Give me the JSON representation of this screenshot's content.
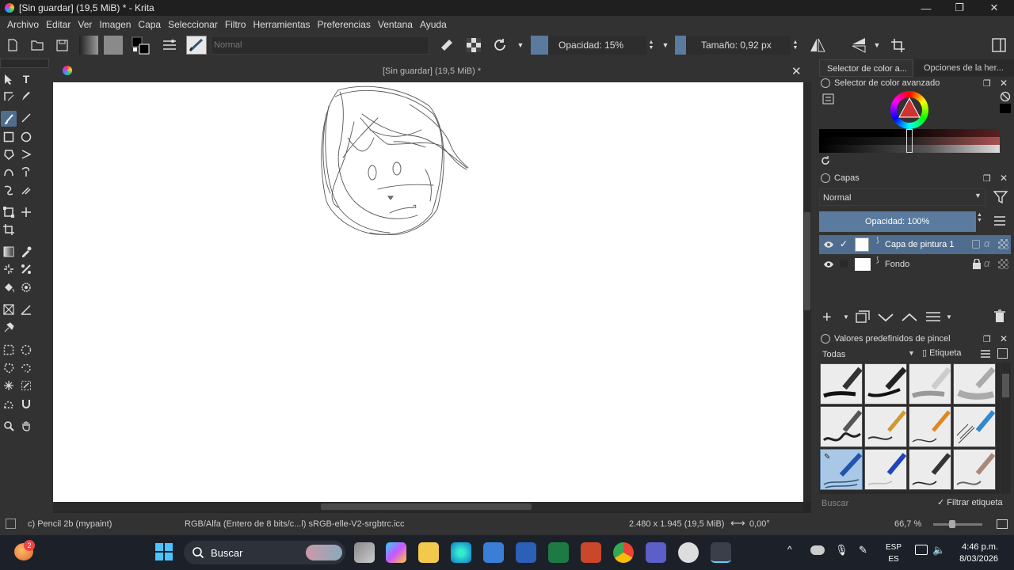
{
  "window": {
    "title": "[Sin guardar]  (19,5 MiB) * - Krita",
    "minimize": "—",
    "maximize": "❐",
    "close": "✕"
  },
  "menu": [
    "Archivo",
    "Editar",
    "Ver",
    "Imagen",
    "Capa",
    "Seleccionar",
    "Filtro",
    "Herramientas",
    "Preferencias",
    "Ventana",
    "Ayuda"
  ],
  "toolbar": {
    "blend_mode": "Normal",
    "opacity": "Opacidad: 15%",
    "size": "Tamaño: 0,92 px"
  },
  "document": {
    "title": "[Sin guardar]  (19,5 MiB) *",
    "close": "✕"
  },
  "dock": {
    "tabs": [
      "Selector de color a...",
      "Opciones de la her..."
    ],
    "color_panel_title": "Selector de color avanzado",
    "layers_title": "Capas",
    "layer_blend": "Normal",
    "layer_opacity": "Opacidad:  100%",
    "layers": [
      {
        "name": "Capa de pintura 1",
        "selected": true
      },
      {
        "name": "Fondo",
        "selected": false
      }
    ],
    "brush_title": "Valores predefinidos de pincel",
    "brush_filter": "Todas",
    "brush_tag": "Etiqueta",
    "search_placeholder": "Buscar",
    "filter_tag": "Filtrar etiqueta"
  },
  "status": {
    "brush": "c) Pencil 2b (mypaint)",
    "color_space": "RGB/Alfa (Entero de 8 bits/c...l)  sRGB-elle-V2-srgbtrc.icc",
    "dimensions": "2.480 x 1.945 (19,5 MiB)",
    "rotation": "0,00°",
    "zoom": "66,7 %"
  },
  "taskbar": {
    "search": "Buscar",
    "badge": "2",
    "lang1": "ESP",
    "lang2": "ES",
    "time": "4:46 p.m.",
    "date": "8/03/2026"
  },
  "colors": {
    "accent": "#5a7a9e",
    "background": "#323232",
    "canvas": "#ffffff",
    "selected_layer": "#4f6d8f"
  }
}
